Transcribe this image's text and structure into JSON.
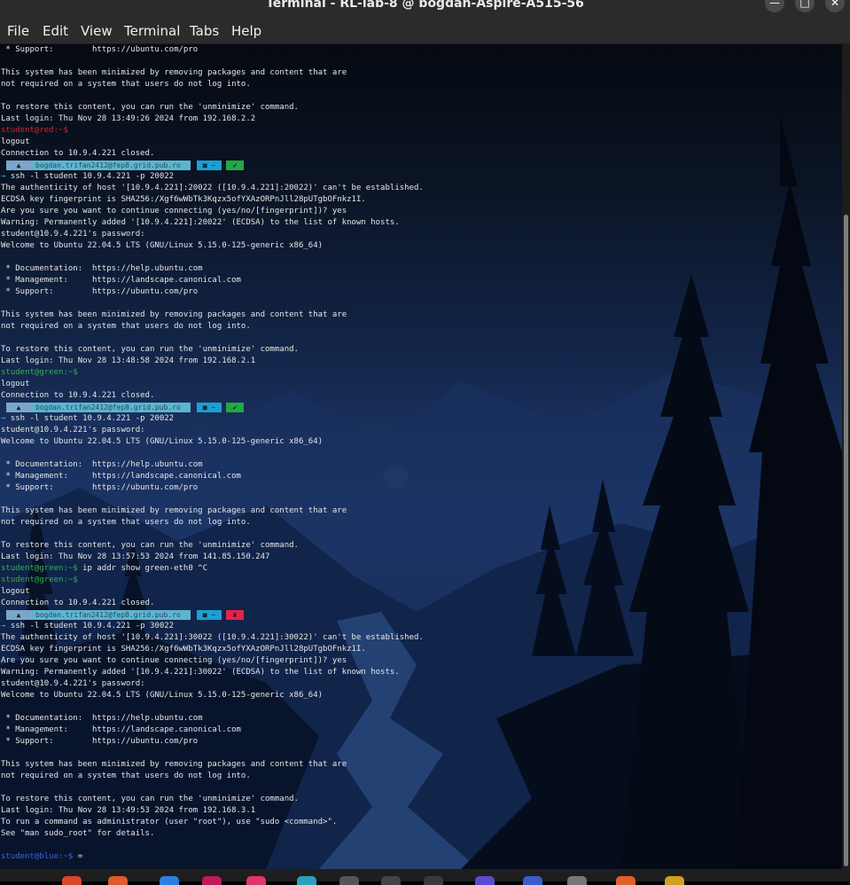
{
  "window": {
    "title": "Terminal - RL-lab-8 @ bogdan-Aspire-A515-56"
  },
  "window_controls": {
    "minimize": "—",
    "maximize": "□",
    "close": "✕"
  },
  "menu": [
    "File",
    "Edit",
    "View",
    "Terminal",
    "Tabs",
    "Help"
  ],
  "powerline": {
    "user": "bogdan.trifan2412@fep8.grid.pub.ro",
    "dir": "~",
    "status_ok": "✔",
    "status_fail": "✘",
    "colors": {
      "ok": "#22a845",
      "fail": "#e0254a"
    }
  },
  "lines": [
    {
      "t": "text",
      "s": " * Support:        https://ubuntu.com/pro"
    },
    {
      "t": "text",
      "s": ""
    },
    {
      "t": "text",
      "s": "This system has been minimized by removing packages and content that are"
    },
    {
      "t": "text",
      "s": "not required on a system that users do not log into."
    },
    {
      "t": "text",
      "s": ""
    },
    {
      "t": "text",
      "s": "To restore this content, you can run the 'unminimize' command."
    },
    {
      "t": "text",
      "s": "Last login: Thu Nov 28 13:49:26 2024 from 192.168.2.2"
    },
    {
      "t": "prompt",
      "p": "student@red:~$",
      "c": "red",
      "s": ""
    },
    {
      "t": "text",
      "s": "logout"
    },
    {
      "t": "text",
      "s": "Connection to 10.9.4.221 closed."
    },
    {
      "t": "powerline",
      "status": "ok"
    },
    {
      "t": "cmd",
      "s": "ssh -l student 10.9.4.221 -p 20022"
    },
    {
      "t": "text",
      "s": "The authenticity of host '[10.9.4.221]:20022 ([10.9.4.221]:20022)' can't be established."
    },
    {
      "t": "text",
      "s": "ECDSA key fingerprint is SHA256:/Xgf6wWbTk3Kqzx5ofYXAzORPnJll28pUTgbOFnkz1I."
    },
    {
      "t": "text",
      "s": "Are you sure you want to continue connecting (yes/no/[fingerprint])? yes"
    },
    {
      "t": "text",
      "s": "Warning: Permanently added '[10.9.4.221]:20022' (ECDSA) to the list of known hosts."
    },
    {
      "t": "text",
      "s": "student@10.9.4.221's password:"
    },
    {
      "t": "text",
      "s": "Welcome to Ubuntu 22.04.5 LTS (GNU/Linux 5.15.0-125-generic x86_64)"
    },
    {
      "t": "text",
      "s": ""
    },
    {
      "t": "text",
      "s": " * Documentation:  https://help.ubuntu.com"
    },
    {
      "t": "text",
      "s": " * Management:     https://landscape.canonical.com"
    },
    {
      "t": "text",
      "s": " * Support:        https://ubuntu.com/pro"
    },
    {
      "t": "text",
      "s": ""
    },
    {
      "t": "text",
      "s": "This system has been minimized by removing packages and content that are"
    },
    {
      "t": "text",
      "s": "not required on a system that users do not log into."
    },
    {
      "t": "text",
      "s": ""
    },
    {
      "t": "text",
      "s": "To restore this content, you can run the 'unminimize' command."
    },
    {
      "t": "text",
      "s": "Last login: Thu Nov 28 13:48:58 2024 from 192.168.2.1"
    },
    {
      "t": "prompt",
      "p": "student@green:~$",
      "c": "green",
      "s": ""
    },
    {
      "t": "text",
      "s": "logout"
    },
    {
      "t": "text",
      "s": "Connection to 10.9.4.221 closed."
    },
    {
      "t": "powerline",
      "status": "ok"
    },
    {
      "t": "cmd",
      "s": "ssh -l student 10.9.4.221 -p 20022"
    },
    {
      "t": "text",
      "s": "student@10.9.4.221's password:"
    },
    {
      "t": "text",
      "s": "Welcome to Ubuntu 22.04.5 LTS (GNU/Linux 5.15.0-125-generic x86_64)"
    },
    {
      "t": "text",
      "s": ""
    },
    {
      "t": "text",
      "s": " * Documentation:  https://help.ubuntu.com"
    },
    {
      "t": "text",
      "s": " * Management:     https://landscape.canonical.com"
    },
    {
      "t": "text",
      "s": " * Support:        https://ubuntu.com/pro"
    },
    {
      "t": "text",
      "s": ""
    },
    {
      "t": "text",
      "s": "This system has been minimized by removing packages and content that are"
    },
    {
      "t": "text",
      "s": "not required on a system that users do not log into."
    },
    {
      "t": "text",
      "s": ""
    },
    {
      "t": "text",
      "s": "To restore this content, you can run the 'unminimize' command."
    },
    {
      "t": "text",
      "s": "Last login: Thu Nov 28 13:57:53 2024 from 141.85.150.247"
    },
    {
      "t": "prompt",
      "p": "student@green:~$",
      "c": "green",
      "s": " ip addr show green-eth0 ^C"
    },
    {
      "t": "prompt",
      "p": "student@green:~$",
      "c": "green",
      "s": ""
    },
    {
      "t": "text",
      "s": "logout"
    },
    {
      "t": "text",
      "s": "Connection to 10.9.4.221 closed."
    },
    {
      "t": "powerline",
      "status": "fail"
    },
    {
      "t": "cmd",
      "s": "ssh -l student 10.9.4.221 -p 30022"
    },
    {
      "t": "text",
      "s": "The authenticity of host '[10.9.4.221]:30022 ([10.9.4.221]:30022)' can't be established."
    },
    {
      "t": "text",
      "s": "ECDSA key fingerprint is SHA256:/Xgf6wWbTk3Kqzx5ofYXAzORPnJll28pUTgbOFnkz1I."
    },
    {
      "t": "text",
      "s": "Are you sure you want to continue connecting (yes/no/[fingerprint])? yes"
    },
    {
      "t": "text",
      "s": "Warning: Permanently added '[10.9.4.221]:30022' (ECDSA) to the list of known hosts."
    },
    {
      "t": "text",
      "s": "student@10.9.4.221's password:"
    },
    {
      "t": "text",
      "s": "Welcome to Ubuntu 22.04.5 LTS (GNU/Linux 5.15.0-125-generic x86_64)"
    },
    {
      "t": "text",
      "s": ""
    },
    {
      "t": "text",
      "s": " * Documentation:  https://help.ubuntu.com"
    },
    {
      "t": "text",
      "s": " * Management:     https://landscape.canonical.com"
    },
    {
      "t": "text",
      "s": " * Support:        https://ubuntu.com/pro"
    },
    {
      "t": "text",
      "s": ""
    },
    {
      "t": "text",
      "s": "This system has been minimized by removing packages and content that are"
    },
    {
      "t": "text",
      "s": "not required on a system that users do not log into."
    },
    {
      "t": "text",
      "s": ""
    },
    {
      "t": "text",
      "s": "To restore this content, you can run the 'unminimize' command."
    },
    {
      "t": "text",
      "s": "Last login: Thu Nov 28 13:49:53 2024 from 192.168.3.1"
    },
    {
      "t": "text",
      "s": "To run a command as administrator (user \"root\"), use \"sudo <command>\"."
    },
    {
      "t": "text",
      "s": "See \"man sudo_root\" for details."
    },
    {
      "t": "text",
      "s": ""
    },
    {
      "t": "prompt",
      "p": "student@blue:~$",
      "c": "blue",
      "s": " ="
    }
  ]
}
